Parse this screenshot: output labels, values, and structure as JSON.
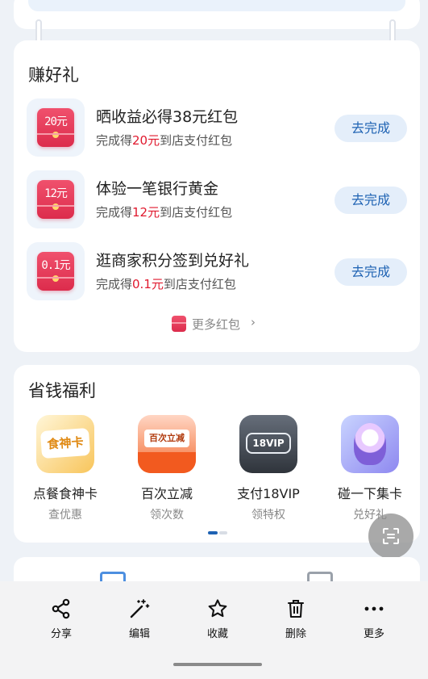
{
  "tasks_section": {
    "title": "赚好礼",
    "tasks": [
      {
        "amount": "20元",
        "title": "晒收益必得38元红包",
        "sub_prefix": "完成得",
        "sub_value": "20元",
        "sub_suffix": "到店支付红包",
        "button": "去完成"
      },
      {
        "amount": "12元",
        "title": "体验一笔银行黄金",
        "sub_prefix": "完成得",
        "sub_value": "12元",
        "sub_suffix": "到店支付红包",
        "button": "去完成"
      },
      {
        "amount": "0.1元",
        "title": "逛商家积分签到兑好礼",
        "sub_prefix": "完成得",
        "sub_value": "0.1元",
        "sub_suffix": "到店支付红包",
        "button": "去完成"
      }
    ],
    "more_link": "更多红包",
    "more_chevron": "›"
  },
  "welfare_section": {
    "title": "省钱福利",
    "perks": [
      {
        "label": "点餐食神卡",
        "sub": "查优惠",
        "icon": "food-card-icon",
        "icon_text": "食神卡"
      },
      {
        "label": "百次立减",
        "sub": "领次数",
        "icon": "discount-icon",
        "icon_text": "百次立减"
      },
      {
        "label": "支付18VIP",
        "sub": "领特权",
        "icon": "vip-icon",
        "icon_text": "18VIP"
      },
      {
        "label": "碰一下集卡",
        "sub": "兑好礼",
        "icon": "collect-card-icon",
        "icon_text": ""
      }
    ],
    "page_indicator": {
      "pages": 2,
      "active": 1
    }
  },
  "action_sheet": {
    "actions": [
      {
        "label": "分享",
        "icon": "share-icon"
      },
      {
        "label": "编辑",
        "icon": "magic-wand-icon"
      },
      {
        "label": "收藏",
        "icon": "star-icon"
      },
      {
        "label": "删除",
        "icon": "trash-icon"
      },
      {
        "label": "更多",
        "icon": "more-dots-icon"
      }
    ]
  },
  "colors": {
    "accent_blue": "#1e62b3",
    "button_bg": "#e4eefa",
    "highlight_red": "#e0192e",
    "envelope_red": "#e8395a",
    "page_bg": "#eef2f7"
  }
}
